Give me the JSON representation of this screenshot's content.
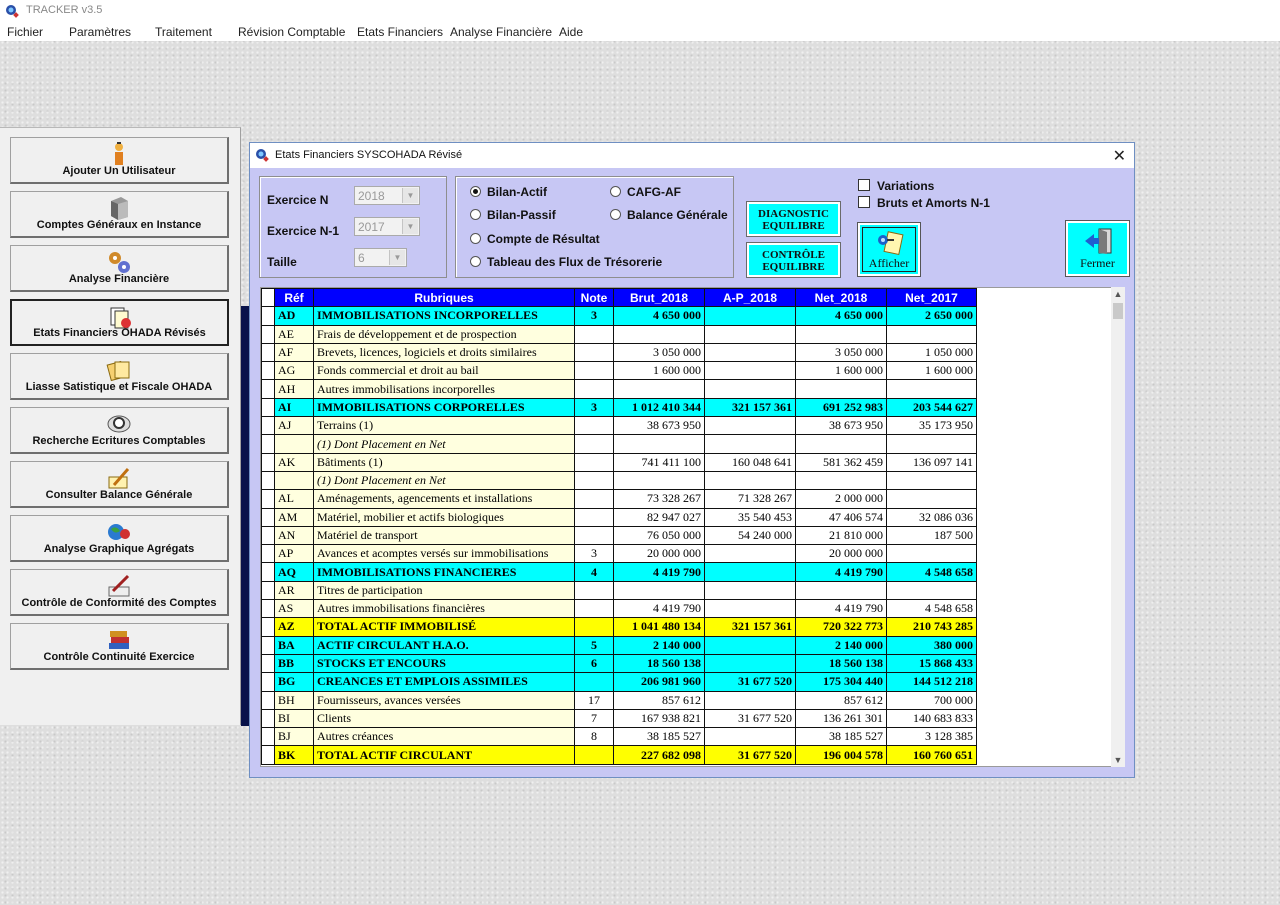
{
  "app": {
    "title": "TRACKER v3.5"
  },
  "menu": [
    "Fichier",
    "Paramètres",
    "Traitement",
    "Révision Comptable",
    "Etats Financiers",
    "Analyse Financière",
    "Aide"
  ],
  "nav": [
    {
      "label": "Ajouter Un Utilisateur",
      "icon": "user-icon"
    },
    {
      "label": "Comptes Généraux en Instance",
      "icon": "server-icon"
    },
    {
      "label": "Analyse Financière",
      "icon": "gears-icon"
    },
    {
      "label": "Etats Financiers OHADA Révisés",
      "icon": "documents-icon"
    },
    {
      "label": "Liasse Satistique et Fiscale OHADA",
      "icon": "folders-icon"
    },
    {
      "label": "Recherche Ecritures Comptables",
      "icon": "magnifier-icon"
    },
    {
      "label": "Consulter Balance Générale",
      "icon": "pen-icon"
    },
    {
      "label": "Analyse Graphique Agrégats",
      "icon": "globe-icon"
    },
    {
      "label": "Contrôle de Conformité des Comptes",
      "icon": "signature-icon"
    },
    {
      "label": "Contrôle Continuité Exercice",
      "icon": "books-icon"
    }
  ],
  "dialog": {
    "title": "Etats Financiers SYSCOHADA Révisé",
    "exercice_n_label": "Exercice N",
    "exercice_n_value": "2018",
    "exercice_n1_label": "Exercice N-1",
    "exercice_n1_value": "2017",
    "taille_label": "Taille",
    "taille_value": "6",
    "radios": {
      "bilan_actif": "Bilan-Actif",
      "bilan_passif": "Bilan-Passif",
      "compte_resultat": "Compte de Résultat",
      "tft": "Tableau des Flux de Trésorerie",
      "cafg": "CAFG-AF",
      "balance": "Balance Générale"
    },
    "diagnostic_line1": "DIAGNOSTIC",
    "diagnostic_line2": "EQUILIBRE",
    "controle_line1": "CONTRÔLE",
    "controle_line2": "EQUILIBRE",
    "afficher": "Afficher",
    "fermer": "Fermer",
    "chk_variations": "Variations",
    "chk_bruts": "Bruts et Amorts N-1"
  },
  "table": {
    "headers": [
      "Réf",
      "Rubriques",
      "Note",
      "Brut_2018",
      "A-P_2018",
      "Net_2018",
      "Net_2017"
    ],
    "rows": [
      {
        "style": "cyan",
        "ref": "AD",
        "rub": "IMMOBILISATIONS INCORPORELLES",
        "note": "3",
        "brut": "4 650 000",
        "ap": "",
        "net18": "4 650 000",
        "net17": "2 650 000"
      },
      {
        "style": "light",
        "ref": "AE",
        "rub": "Frais de développement et de prospection",
        "note": "",
        "brut": "",
        "ap": "",
        "net18": "",
        "net17": ""
      },
      {
        "style": "light",
        "ref": "AF",
        "rub": "Brevets, licences, logiciels et droits similaires",
        "note": "",
        "brut": "3 050 000",
        "ap": "",
        "net18": "3 050 000",
        "net17": "1 050 000"
      },
      {
        "style": "light",
        "ref": "AG",
        "rub": "Fonds commercial et droit au bail",
        "note": "",
        "brut": "1 600 000",
        "ap": "",
        "net18": "1 600 000",
        "net17": "1 600 000"
      },
      {
        "style": "light",
        "ref": "AH",
        "rub": "Autres immobilisations incorporelles",
        "note": "",
        "brut": "",
        "ap": "",
        "net18": "",
        "net17": ""
      },
      {
        "style": "cyan",
        "ref": "AI",
        "rub": "IMMOBILISATIONS CORPORELLES",
        "note": "3",
        "brut": "1 012 410 344",
        "ap": "321 157 361",
        "net18": "691 252 983",
        "net17": "203 544 627"
      },
      {
        "style": "light",
        "ref": "AJ",
        "rub": "Terrains (1)",
        "note": "",
        "brut": "38 673 950",
        "ap": "",
        "net18": "38 673 950",
        "net17": "35 173 950"
      },
      {
        "style": "light italic",
        "ref": "",
        "rub": "(1) Dont Placement en Net",
        "note": "",
        "brut": "",
        "ap": "",
        "net18": "",
        "net17": ""
      },
      {
        "style": "light",
        "ref": "AK",
        "rub": "Bâtiments (1)",
        "note": "",
        "brut": "741 411 100",
        "ap": "160 048 641",
        "net18": "581 362 459",
        "net17": "136 097 141"
      },
      {
        "style": "light italic",
        "ref": "",
        "rub": "(1) Dont Placement en Net",
        "note": "",
        "brut": "",
        "ap": "",
        "net18": "",
        "net17": ""
      },
      {
        "style": "light",
        "ref": "AL",
        "rub": "Aménagements, agencements et installations",
        "note": "",
        "brut": "73 328 267",
        "ap": "71 328 267",
        "net18": "2 000 000",
        "net17": ""
      },
      {
        "style": "light",
        "ref": "AM",
        "rub": "Matériel, mobilier et actifs biologiques",
        "note": "",
        "brut": "82 947 027",
        "ap": "35 540 453",
        "net18": "47 406 574",
        "net17": "32 086 036"
      },
      {
        "style": "light",
        "ref": "AN",
        "rub": "Matériel de transport",
        "note": "",
        "brut": "76 050 000",
        "ap": "54 240 000",
        "net18": "21 810 000",
        "net17": "187 500"
      },
      {
        "style": "light",
        "ref": "AP",
        "rub": "Avances et acomptes versés sur immobilisations",
        "note": "3",
        "brut": "20 000 000",
        "ap": "",
        "net18": "20 000 000",
        "net17": ""
      },
      {
        "style": "cyan",
        "ref": "AQ",
        "rub": "IMMOBILISATIONS FINANCIERES",
        "note": "4",
        "brut": "4 419 790",
        "ap": "",
        "net18": "4 419 790",
        "net17": "4 548 658"
      },
      {
        "style": "light",
        "ref": "AR",
        "rub": "Titres de participation",
        "note": "",
        "brut": "",
        "ap": "",
        "net18": "",
        "net17": ""
      },
      {
        "style": "light",
        "ref": "AS",
        "rub": "Autres immobilisations financières",
        "note": "",
        "brut": "4 419 790",
        "ap": "",
        "net18": "4 419 790",
        "net17": "4 548 658"
      },
      {
        "style": "yellow",
        "ref": "AZ",
        "rub": "TOTAL ACTIF IMMOBILISÉ",
        "note": "",
        "brut": "1 041 480 134",
        "ap": "321 157 361",
        "net18": "720 322 773",
        "net17": "210 743 285"
      },
      {
        "style": "cyan",
        "ref": "BA",
        "rub": "ACTIF CIRCULANT H.A.O.",
        "note": "5",
        "brut": "2 140 000",
        "ap": "",
        "net18": "2 140 000",
        "net17": "380 000"
      },
      {
        "style": "cyan",
        "ref": "BB",
        "rub": "STOCKS ET ENCOURS",
        "note": "6",
        "brut": "18 560 138",
        "ap": "",
        "net18": "18 560 138",
        "net17": "15 868 433"
      },
      {
        "style": "cyan",
        "ref": "BG",
        "rub": "CREANCES ET EMPLOIS ASSIMILES",
        "note": "",
        "brut": "206 981 960",
        "ap": "31 677 520",
        "net18": "175 304 440",
        "net17": "144 512 218"
      },
      {
        "style": "light",
        "ref": "BH",
        "rub": "Fournisseurs, avances versées",
        "note": "17",
        "brut": "857 612",
        "ap": "",
        "net18": "857 612",
        "net17": "700 000"
      },
      {
        "style": "light",
        "ref": "BI",
        "rub": "Clients",
        "note": "7",
        "brut": "167 938 821",
        "ap": "31 677 520",
        "net18": "136 261 301",
        "net17": "140 683 833"
      },
      {
        "style": "light",
        "ref": "BJ",
        "rub": "Autres créances",
        "note": "8",
        "brut": "38 185 527",
        "ap": "",
        "net18": "38 185 527",
        "net17": "3 128 385"
      },
      {
        "style": "yellow",
        "ref": "BK",
        "rub": "TOTAL ACTIF CIRCULANT",
        "note": "",
        "brut": "227 682 098",
        "ap": "31 677 520",
        "net18": "196 004 578",
        "net17": "160 760 651"
      }
    ]
  }
}
